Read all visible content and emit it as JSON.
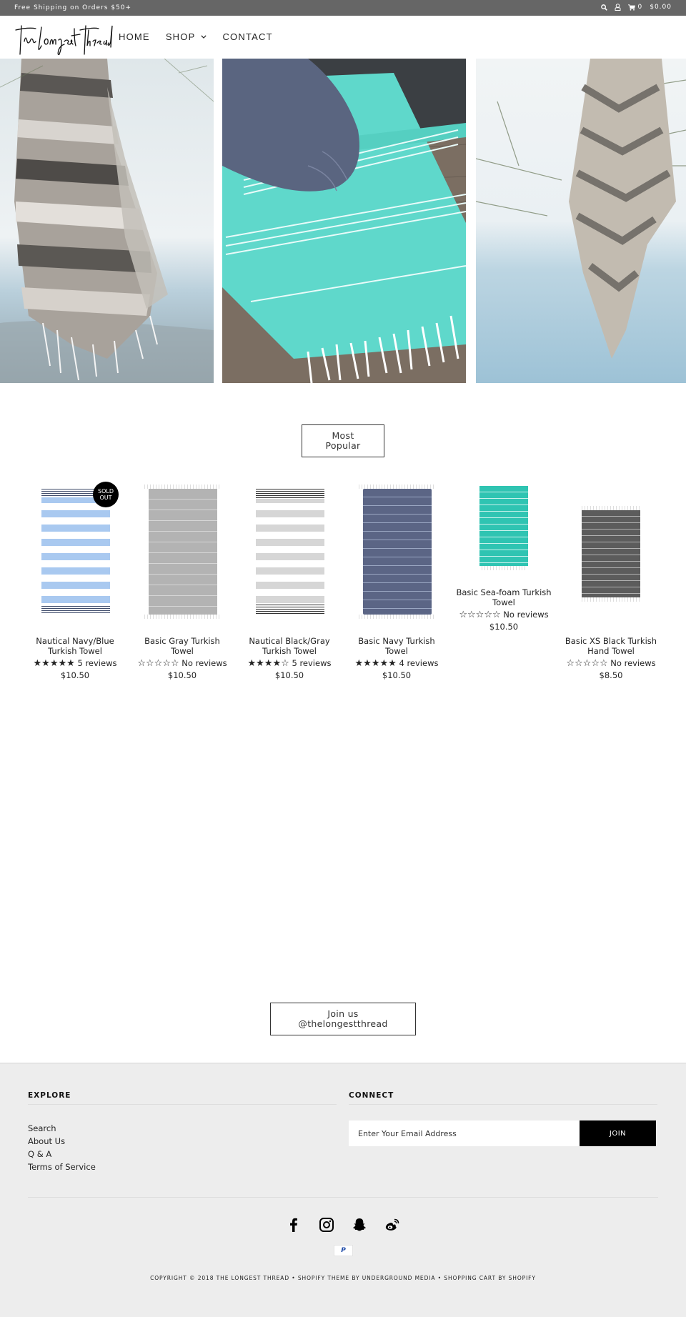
{
  "topbar": {
    "promo": "Free Shipping on Orders $50+",
    "cart_count": "0",
    "cart_total": "$0.00"
  },
  "header": {
    "logo_text": "the longest thread",
    "nav": [
      {
        "label": "HOME"
      },
      {
        "label": "SHOP",
        "has_dropdown": true
      },
      {
        "label": "CONTACT"
      }
    ]
  },
  "hero": {
    "images": [
      {
        "alt": "Gray striped towel hanging by the water"
      },
      {
        "alt": "Navy and sea-foam towels on wooden bench"
      },
      {
        "alt": "Gray chevron towel hanging from tree"
      }
    ]
  },
  "collection_button": {
    "line1": "Most",
    "line2": "Popular"
  },
  "products": [
    {
      "name": "Nautical Navy/Blue Turkish Towel",
      "rating": 5,
      "reviews": "5 reviews",
      "price": "$10.50",
      "badge": "SOLD OUT",
      "color": "#a9c9f0"
    },
    {
      "name": "Basic Gray Turkish Towel",
      "rating": 0,
      "reviews": "No reviews",
      "price": "$10.50",
      "color": "#b3b3b3"
    },
    {
      "name": "Nautical Black/Gray Turkish Towel",
      "rating": 4,
      "reviews": "5 reviews",
      "price": "$10.50",
      "color": "#d6d6d6"
    },
    {
      "name": "Basic Navy Turkish Towel",
      "rating": 5,
      "reviews": "4 reviews",
      "price": "$10.50",
      "color": "#5b6585"
    },
    {
      "name": "Basic Sea-foam Turkish Towel",
      "rating": 0,
      "reviews": "No reviews",
      "price": "$10.50",
      "color": "#2fc4b2"
    },
    {
      "name": "Basic XS Black Turkish Hand Towel",
      "rating": 0,
      "reviews": "No reviews",
      "price": "$8.50",
      "color": "#5c5c5c"
    }
  ],
  "instagram_button": {
    "line1": "Join us",
    "line2": "@thelongestthread"
  },
  "footer": {
    "explore": {
      "title": "EXPLORE",
      "links": [
        "Search",
        "About Us",
        "Q & A",
        "Terms of Service"
      ]
    },
    "connect": {
      "title": "CONNECT",
      "email_placeholder": "Enter Your Email Address",
      "join_label": "JOIN"
    },
    "social": [
      "facebook",
      "instagram",
      "snapchat",
      "weibo"
    ],
    "payment": "P",
    "copyright": "COPYRIGHT © 2018 THE LONGEST THREAD • SHOPIFY THEME BY UNDERGROUND MEDIA •  SHOPPING CART BY SHOPIFY"
  }
}
